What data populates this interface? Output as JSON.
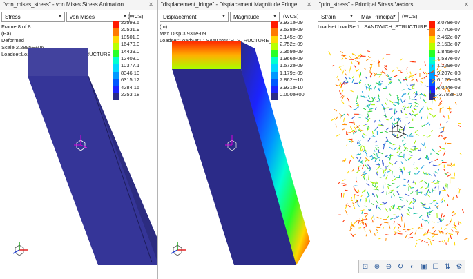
{
  "panels": [
    {
      "title": "\"von_mises_stress\" - von Mises Stress Animation",
      "select1": "Stress",
      "select2": "von Mises",
      "wcs": "(WCS)",
      "info": [
        "Frame 8 of 8",
        "(Pa)",
        "Deformed",
        "Scale 2.2895E+06",
        "Loadset:LoadSet1 : SANDWICH_STRUCTURE_1"
      ],
      "legend": [
        "22593.5",
        "20531.9",
        "18501.0",
        "16470.0",
        "14439.0",
        "12408.0",
        "10377.1",
        "8346.10",
        "6315.12",
        "4284.15",
        "2253.18"
      ],
      "colors": [
        "#ff1a00",
        "#ff7a00",
        "#ffd800",
        "#b8ff00",
        "#28ff28",
        "#00ffd0",
        "#00d8ff",
        "#0098ff",
        "#0058ff",
        "#1b24ff",
        "#2b2b88"
      ]
    },
    {
      "title": "\"displacement_fringe\" - Displacement Magnitude Fringe",
      "select1": "Displacement",
      "select2": "Magnitude",
      "wcs": "(WCS)",
      "info": [
        "(m)",
        "Max Disp 3.931e-09",
        "Loadset:LoadSet1 : SANDWICH_STRUCTURE_1"
      ],
      "legend": [
        "3.931e-09",
        "3.538e-09",
        "3.145e-09",
        "2.752e-09",
        "2.359e-09",
        "1.966e-09",
        "1.572e-09",
        "1.179e-09",
        "7.862e-10",
        "3.931e-10",
        "0.000e+00"
      ],
      "colors": [
        "#ff1a00",
        "#ff7a00",
        "#ffd800",
        "#b8ff00",
        "#28ff28",
        "#00ffd0",
        "#00d8ff",
        "#0098ff",
        "#0058ff",
        "#1b24ff",
        "#2b2b88"
      ]
    },
    {
      "title": "\"prin_stress\" - Principal Stress Vectors",
      "select1": "Strain",
      "select2": "Max Principal",
      "wcs": "(WCS)",
      "info": [
        "Loadset:LoadSet1 : SANDWICH_STRUCTURE_1"
      ],
      "legend": [
        "3.078e-07",
        "2.770e-07",
        "2.462e-07",
        "2.153e-07",
        "1.845e-07",
        "1.537e-07",
        "1.229e-07",
        "9.207e-08",
        "6.126e-08",
        "3.044e-08",
        "-3.783e-10"
      ],
      "colors": [
        "#ff1a00",
        "#ff7a00",
        "#ffd800",
        "#b8ff00",
        "#28ff28",
        "#00ffd0",
        "#00d8ff",
        "#0098ff",
        "#0058ff",
        "#1b24ff",
        "#2b2b88"
      ]
    }
  ],
  "close_glyph": "✕",
  "caret_glyph": "▼",
  "toolbar_icons": [
    "zoom-fit-icon",
    "zoom-in-icon",
    "zoom-out-icon",
    "refit-icon",
    "spin-icon",
    "view-icon",
    "saved-views-icon",
    "display-icon",
    "settings-icon"
  ]
}
